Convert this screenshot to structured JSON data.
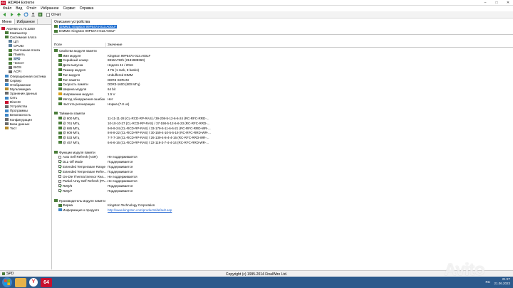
{
  "window": {
    "app_icon_text": "64",
    "title": "AIDA64 Extreme",
    "controls": [
      "–",
      "□",
      "✕"
    ]
  },
  "menu": [
    "Файл",
    "Вид",
    "Отчёт",
    "Избранное",
    "Сервис",
    "Справка"
  ],
  "toolbar": {
    "report_label": "Отчет"
  },
  "left_tabs": [
    "Меню",
    "Избранное"
  ],
  "tree": [
    {
      "label": "AIDA64 v4.70.3200",
      "level": 0,
      "color": "#c8102e"
    },
    {
      "label": "Компьютер",
      "level": 1,
      "color": "#4a7d3a"
    },
    {
      "label": "Системная плата",
      "level": 1,
      "color": "#4a7d3a"
    },
    {
      "label": "ЦП",
      "level": 2,
      "color": "#5a7f9c"
    },
    {
      "label": "CPUID",
      "level": 2,
      "color": "#5a7f9c"
    },
    {
      "label": "Системная плата",
      "level": 2,
      "color": "#4a7d3a"
    },
    {
      "label": "Память",
      "level": 2,
      "color": "#4a7d3a"
    },
    {
      "label": "SPD",
      "level": 2,
      "color": "#4a7d3a",
      "selected": true
    },
    {
      "label": "Чипсет",
      "level": 2,
      "color": "#4a7d3a"
    },
    {
      "label": "BIOS",
      "level": 2,
      "color": "#6b6b6b"
    },
    {
      "label": "ACPI",
      "level": 2,
      "color": "#6b6b6b"
    },
    {
      "label": "Операционная система",
      "level": 1,
      "color": "#3d86c6"
    },
    {
      "label": "Сервер",
      "level": 1,
      "color": "#6b6b6b"
    },
    {
      "label": "Отображение",
      "level": 1,
      "color": "#3d86c6"
    },
    {
      "label": "Мультимедиа",
      "level": 1,
      "color": "#b58a2a"
    },
    {
      "label": "Хранение данных",
      "level": 1,
      "color": "#6b6b6b"
    },
    {
      "label": "Сеть",
      "level": 1,
      "color": "#3d86c6"
    },
    {
      "label": "DirectX",
      "level": 1,
      "color": "#c8102e"
    },
    {
      "label": "Устройства",
      "level": 1,
      "color": "#6b6b6b"
    },
    {
      "label": "Программы",
      "level": 1,
      "color": "#3d86c6"
    },
    {
      "label": "Безопасность",
      "level": 1,
      "color": "#3d86c6"
    },
    {
      "label": "Конфигурация",
      "level": 1,
      "color": "#6b6b6b"
    },
    {
      "label": "База данных",
      "level": 1,
      "color": "#6b6b6b"
    },
    {
      "label": "Тест",
      "level": 1,
      "color": "#b58a2a"
    }
  ],
  "device_header": "Описание устройства",
  "devices": [
    {
      "label": "DIMM1: Kingston 99P5474-013.A00LF",
      "selected": true
    },
    {
      "label": "DIMM3: Kingston 99P5474-013.A00LF",
      "selected": false
    }
  ],
  "columns": {
    "field": "Поле",
    "value": "Значение"
  },
  "detail": [
    {
      "kind": "section",
      "field": "Свойства модуля памяти",
      "value": "",
      "icon": "#4a7d3a"
    },
    {
      "kind": "item",
      "field": "Имя модуля",
      "value": "Kingston 99P5474-013.A00LF",
      "icon": "#4a7d3a"
    },
    {
      "kind": "item",
      "field": "Серийный номер",
      "value": "8816A782h (2181988360)",
      "icon": "#4a7d3a"
    },
    {
      "kind": "item",
      "field": "Дата выпуска",
      "value": "Неделя 41 / 2016",
      "icon": "#4a7d3a"
    },
    {
      "kind": "item",
      "field": "Размер модуля",
      "value": "4 ГБ (1 rank, 8 banks)",
      "icon": "#4a7d3a"
    },
    {
      "kind": "item",
      "field": "Тип модуля",
      "value": "Unbuffered DIMM",
      "icon": "#4a7d3a"
    },
    {
      "kind": "item",
      "field": "Тип памяти",
      "value": "DDR3 SDRAM",
      "icon": "#4a7d3a"
    },
    {
      "kind": "item",
      "field": "Скорость памяти",
      "value": "DDR3-1600 (800 МГц)",
      "icon": "#4a7d3a"
    },
    {
      "kind": "item",
      "field": "Ширина модуля",
      "value": "64 bit",
      "icon": "#4a7d3a"
    },
    {
      "kind": "item",
      "field": "Напряжение модуля",
      "value": "1.5 V",
      "icon": "#d9a11c"
    },
    {
      "kind": "item",
      "field": "Метод обнаружения ошибок",
      "value": "Нет",
      "icon": "#4a7d3a"
    },
    {
      "kind": "item",
      "field": "Частота регенерации",
      "value": "Норма (7.8 us)",
      "icon": "#4a7d3a"
    },
    {
      "kind": "blank"
    },
    {
      "kind": "section",
      "field": "Тайминги памяти",
      "value": "",
      "icon": "#4a7d3a"
    },
    {
      "kind": "item",
      "field": "@ 800 МГц",
      "value": "11-11-11-28  (CL-RCD-RP-RAS) / 39-208-5-12-6-6-24  (RC-RFC-RRD-...",
      "icon": "#4a7d3a"
    },
    {
      "kind": "item",
      "field": "@ 761 МГц",
      "value": "10-10-10-27  (CL-RCD-RP-RAS) / 37-198-5-12-6-6-23  (RC-RFC-RRD-...",
      "icon": "#4a7d3a"
    },
    {
      "kind": "item",
      "field": "@ 685 МГц",
      "value": "9-9-9-24  (CL-RCD-RP-RAS) / 33-179-5-11-6-6-21  (RC-RFC-RRD-WR-...",
      "icon": "#4a7d3a"
    },
    {
      "kind": "item",
      "field": "@ 609 МГц",
      "value": "8-8-8-22  (CL-RCD-RP-RAS) / 30-159-4-10-5-5-19  (RC-RFC-RRD-WR-...",
      "icon": "#4a7d3a"
    },
    {
      "kind": "item",
      "field": "@ 533 МГц",
      "value": "7-7-7-19  (CL-RCD-RP-RAS) / 26-139-4-8-4-4-16  (RC-RFC-RRD-WR-...",
      "icon": "#4a7d3a"
    },
    {
      "kind": "item",
      "field": "@ 457 МГц",
      "value": "6-6-6-16  (CL-RCD-RP-RAS) / 22-119-3-7-4-4-14  (RC-RFC-RRD-WR-...",
      "icon": "#4a7d3a"
    },
    {
      "kind": "blank"
    },
    {
      "kind": "section",
      "field": "Функции модуля памяти",
      "value": "",
      "icon": "#4a7d3a"
    },
    {
      "kind": "item",
      "field": "Auto Self Refresh (ASR)",
      "value": "Не поддерживается",
      "icon": "checkbox",
      "checked": false
    },
    {
      "kind": "item",
      "field": "DLL-Off Mode",
      "value": "Поддерживается",
      "icon": "checkbox",
      "checked": true
    },
    {
      "kind": "item",
      "field": "Extended Temperature Range",
      "value": "Поддерживается",
      "icon": "checkbox",
      "checked": true
    },
    {
      "kind": "item",
      "field": "Extended Temperature Refre...",
      "value": "Поддерживается",
      "icon": "checkbox",
      "checked": true
    },
    {
      "kind": "item",
      "field": "On-Die Thermal Sensor Rea...",
      "value": "Не поддерживается",
      "icon": "checkbox",
      "checked": false
    },
    {
      "kind": "item",
      "field": "Partial Array Self Refresh (PA...",
      "value": "Не поддерживается",
      "icon": "checkbox",
      "checked": false
    },
    {
      "kind": "item",
      "field": "RZQ/6",
      "value": "Поддерживается",
      "icon": "checkbox",
      "checked": true
    },
    {
      "kind": "item",
      "field": "RZQ/7",
      "value": "Поддерживается",
      "icon": "checkbox",
      "checked": true
    },
    {
      "kind": "blank"
    },
    {
      "kind": "section",
      "field": "Производитель модуля памяти",
      "value": "",
      "icon": "#4a7d3a"
    },
    {
      "kind": "item",
      "field": "Фирма",
      "value": "Kingston Technology Corporation",
      "icon": "#4a7d3a"
    },
    {
      "kind": "item",
      "field": "Информация о продукте",
      "value": "http://www.kingston.com/products/default.asp",
      "icon": "#3d86c6",
      "link": true
    }
  ],
  "status": {
    "left": "SPD",
    "center": "Copyright (c) 1995-2014 FinalWire Ltd."
  },
  "taskbar": {
    "apps": [
      {
        "name": "explorer",
        "color": "#e8b34a",
        "text": ""
      },
      {
        "name": "yandex-browser",
        "color": "#ffffff",
        "text": "Y"
      },
      {
        "name": "aida64",
        "color": "#c8102e",
        "text": "64"
      }
    ],
    "lang": "RU",
    "time": "21:27",
    "date": "21.06.2023"
  },
  "watermark": "Avito"
}
